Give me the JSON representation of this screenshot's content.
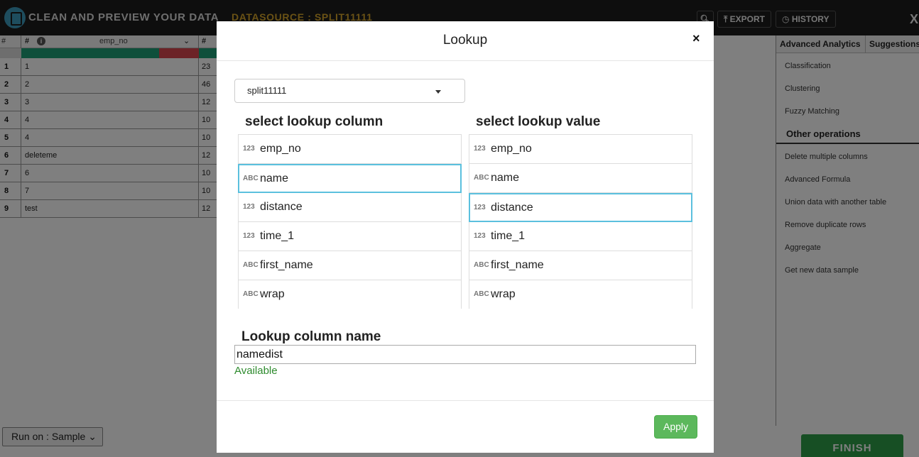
{
  "app": {
    "title": "CLEAN AND PREVIEW YOUR DATA",
    "datasource": "DATASOURCE : SPLIT11111",
    "export_label": "EXPORT",
    "history_label": "HISTORY",
    "close_label": "X",
    "run_on_label": "Run on : Sample",
    "finish_label": "FINISH"
  },
  "grid": {
    "index_header": "#",
    "column_header": "emp_no",
    "column_type": "#",
    "next_type": "#",
    "rows": [
      {
        "idx": "1",
        "value": "1",
        "next": "23"
      },
      {
        "idx": "2",
        "value": "2",
        "next": "46"
      },
      {
        "idx": "3",
        "value": "3",
        "next": "12"
      },
      {
        "idx": "4",
        "value": "4",
        "next": "10"
      },
      {
        "idx": "5",
        "value": "4",
        "next": "10"
      },
      {
        "idx": "6",
        "value": "deleteme",
        "next": "12"
      },
      {
        "idx": "7",
        "value": "6",
        "next": "10"
      },
      {
        "idx": "8",
        "value": "7",
        "next": "10"
      },
      {
        "idx": "9",
        "value": "test",
        "next": "12"
      }
    ]
  },
  "sidebar": {
    "tabs": [
      "Advanced Analytics",
      "Suggestions"
    ],
    "analytics_items": [
      "Classification",
      "Clustering",
      "Fuzzy Matching"
    ],
    "section_title": "Other operations",
    "operation_items": [
      "Delete multiple columns",
      "Advanced Formula",
      "Union data with another table",
      "Remove duplicate rows",
      "Aggregate",
      "Get new data sample"
    ]
  },
  "modal": {
    "title": "Lookup",
    "close": "×",
    "datasource_select": "split11111",
    "column_list_title": "select lookup column",
    "value_list_title": "select lookup value",
    "lookup_columns": [
      {
        "label": "emp_no",
        "type_icon": "123",
        "selected": false
      },
      {
        "label": "name",
        "type_icon": "ABC",
        "selected": true
      },
      {
        "label": "distance",
        "type_icon": "123",
        "selected": false
      },
      {
        "label": "time_1",
        "type_icon": "123",
        "selected": false
      },
      {
        "label": "first_name",
        "type_icon": "ABC",
        "selected": false
      },
      {
        "label": "wrap",
        "type_icon": "ABC",
        "selected": false
      }
    ],
    "lookup_values": [
      {
        "label": "emp_no",
        "type_icon": "123",
        "selected": false
      },
      {
        "label": "name",
        "type_icon": "ABC",
        "selected": false
      },
      {
        "label": "distance",
        "type_icon": "123",
        "selected": true
      },
      {
        "label": "time_1",
        "type_icon": "123",
        "selected": false
      },
      {
        "label": "first_name",
        "type_icon": "ABC",
        "selected": false
      },
      {
        "label": "wrap",
        "type_icon": "ABC",
        "selected": false
      }
    ],
    "lookup_column_name_title": "Lookup column name",
    "lookup_column_name_value": "namedist",
    "availability": "Available",
    "apply_label": "Apply"
  }
}
